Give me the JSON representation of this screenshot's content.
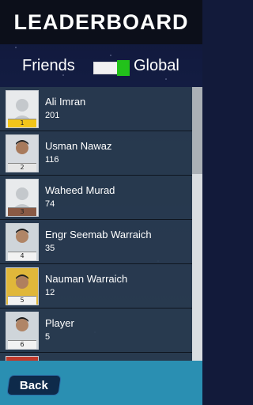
{
  "header": {
    "title": "LEADERBOARD"
  },
  "toggle": {
    "left_label": "Friends",
    "right_label": "Global",
    "selected": "Global",
    "knob_color": "#22c21a"
  },
  "players": [
    {
      "rank": "1",
      "name": "Ali Imran",
      "score": "201",
      "avatar": "placeholder",
      "rank_color": "#f2c51a"
    },
    {
      "rank": "2",
      "name": "Usman Nawaz",
      "score": "116",
      "avatar": "photo",
      "rank_color": "#e6e6e6"
    },
    {
      "rank": "3",
      "name": "Waheed Murad",
      "score": "74",
      "avatar": "placeholder",
      "rank_color": "#8a5a45"
    },
    {
      "rank": "4",
      "name": "Engr Seemab Warraich",
      "score": "35",
      "avatar": "photo",
      "rank_color": "#f2f2f2"
    },
    {
      "rank": "5",
      "name": "Nauman Warraich",
      "score": "12",
      "avatar": "photo-yellow",
      "rank_color": "#f2f2f2"
    },
    {
      "rank": "6",
      "name": "Player",
      "score": "5",
      "avatar": "photo",
      "rank_color": "#f2f2f2"
    }
  ],
  "footer": {
    "back_label": "Back"
  }
}
